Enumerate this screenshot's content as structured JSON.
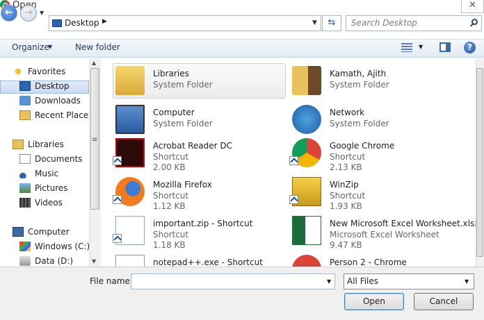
{
  "window": {
    "title": "Open",
    "close_glyph": "✕"
  },
  "nav": {
    "back_glyph": "←",
    "forward_glyph": "→",
    "address": "Desktop",
    "search_placeholder": "Search Desktop"
  },
  "toolbar": {
    "organize": "Organize",
    "new_folder": "New folder",
    "help_glyph": "?"
  },
  "sidebar": {
    "items": [
      {
        "label": "Favorites",
        "icon": "star-icon"
      },
      {
        "label": "Desktop",
        "icon": "desktop-icon",
        "selected": true
      },
      {
        "label": "Downloads",
        "icon": "downloads-icon"
      },
      {
        "label": "Recent Places",
        "icon": "recent-places-icon"
      },
      {
        "label": "Libraries",
        "icon": "libraries-icon"
      },
      {
        "label": "Documents",
        "icon": "documents-icon"
      },
      {
        "label": "Music",
        "icon": "music-icon"
      },
      {
        "label": "Pictures",
        "icon": "pictures-icon"
      },
      {
        "label": "Videos",
        "icon": "videos-icon"
      },
      {
        "label": "Computer",
        "icon": "computer-icon"
      },
      {
        "label": "Windows (C:)",
        "icon": "drive-c-icon"
      },
      {
        "label": "Data (D:)",
        "icon": "drive-d-icon"
      }
    ]
  },
  "files": [
    {
      "name": "Libraries",
      "type": "System Folder",
      "size": "",
      "icon": "libraries-folder-icon"
    },
    {
      "name": "Kamath, Ajith",
      "type": "System Folder",
      "size": "",
      "icon": "user-folder-icon"
    },
    {
      "name": "Computer",
      "type": "System Folder",
      "size": "",
      "icon": "computer-icon"
    },
    {
      "name": "Network",
      "type": "System Folder",
      "size": "",
      "icon": "network-icon"
    },
    {
      "name": "Acrobat Reader DC",
      "type": "Shortcut",
      "size": "2.00 KB",
      "icon": "acrobat-icon"
    },
    {
      "name": "Google Chrome",
      "type": "Shortcut",
      "size": "2.13 KB",
      "icon": "chrome-icon"
    },
    {
      "name": "Mozilla Firefox",
      "type": "Shortcut",
      "size": "1.12 KB",
      "icon": "firefox-icon"
    },
    {
      "name": "WinZip",
      "type": "Shortcut",
      "size": "1.93 KB",
      "icon": "winzip-icon"
    },
    {
      "name": "important.zip - Shortcut",
      "type": "Shortcut",
      "size": "1.18 KB",
      "icon": "zip-icon"
    },
    {
      "name": "New Microsoft Excel Worksheet.xlsx",
      "type": "Microsoft Excel Worksheet",
      "size": "9.47 KB",
      "icon": "excel-icon"
    },
    {
      "name": "notepad++.exe - Shortcut",
      "type": "",
      "size": "",
      "icon": "notepad-icon"
    },
    {
      "name": "Person 2 - Chrome",
      "type": "",
      "size": "",
      "icon": "chrome-person-icon"
    }
  ],
  "footer": {
    "file_name_label": "File name:",
    "file_name_value": "",
    "filter": "All Files",
    "open": "Open",
    "cancel": "Cancel"
  },
  "colors": {
    "accent": "#2b63b6",
    "selection": "#cddcf2"
  }
}
